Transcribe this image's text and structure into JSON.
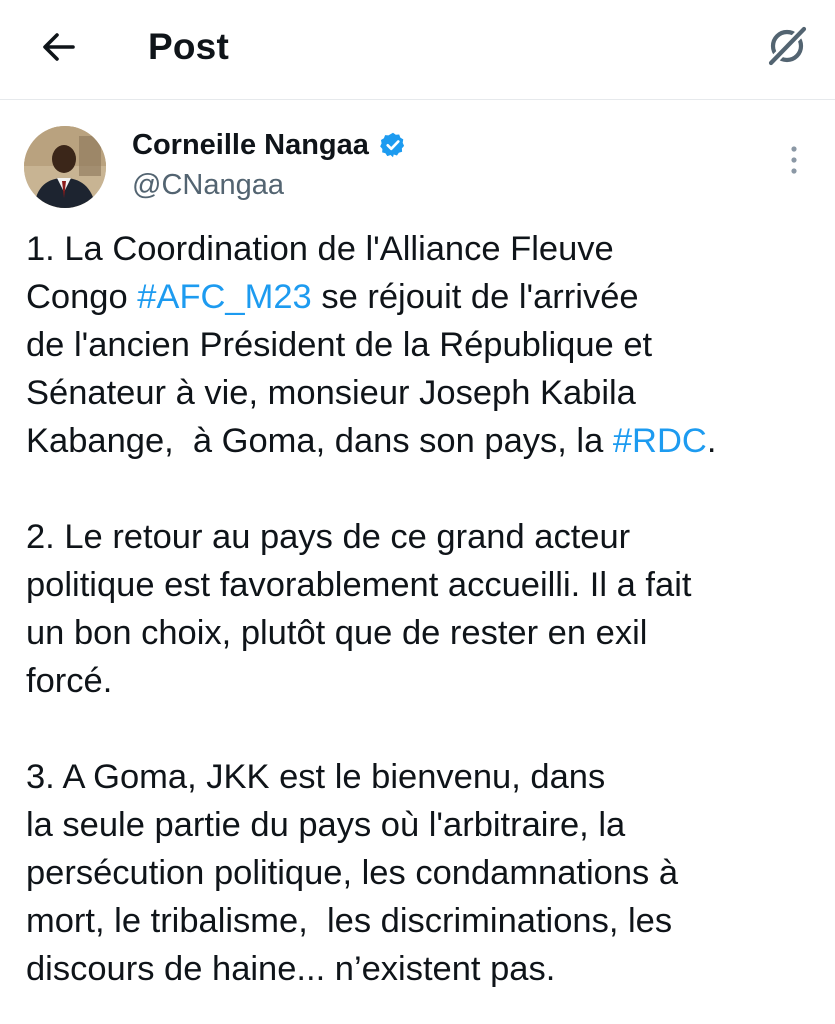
{
  "header": {
    "title": "Post",
    "back_icon": "arrow-left-icon",
    "grok_icon": "grok-slash-circle-icon"
  },
  "author": {
    "name": "Corneille Nangaa",
    "handle": "@CNangaa",
    "verified_color": "#1d9bf0",
    "avatar_icon": "profile-photo"
  },
  "menu": {
    "icon": "more-vertical-icon"
  },
  "post": {
    "p1": {
      "l1": "1. La Coordination de l'Alliance Fleuve",
      "l2_pre": "Congo ",
      "tag1": "#AFC_M23",
      "l2_post": " se réjouit de l'arrivée",
      "l3": "de l'ancien Président de la République et",
      "l4": "Sénateur à vie, monsieur Joseph Kabila",
      "l5_pre": "Kabange,  à Goma, dans son pays, la ",
      "tag2": "#RDC",
      "l5_post": "."
    },
    "p2": {
      "l1": "2. Le retour au pays de ce grand acteur",
      "l2": "politique est favorablement accueilli. Il a fait",
      "l3": "un bon choix, plutôt que de rester en exil",
      "l4": "forcé."
    },
    "p3": {
      "l1": "3. A Goma, JKK est le bienvenu, dans",
      "l2": "la seule partie du pays où l'arbitraire, la",
      "l3": "persécution politique, les condamnations à",
      "l4": "mort, le tribalisme,  les discriminations, les",
      "l5": "discours de haine... n’existent pas."
    }
  },
  "colors": {
    "text": "#0f1419",
    "muted": "#536471",
    "link": "#1d9bf0"
  }
}
